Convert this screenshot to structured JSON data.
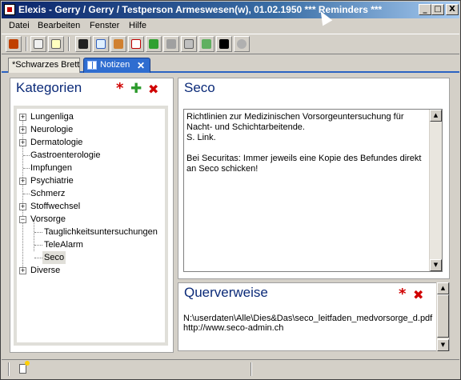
{
  "window": {
    "title": "Elexis - Gerry / Gerry  / Testperson Armeswesen(w), 01.02.1950   *** Reminders ***",
    "controls": {
      "minimize": "_",
      "maximize": "□",
      "close": "X"
    }
  },
  "menu": [
    "Datei",
    "Bearbeiten",
    "Fenster",
    "Hilfe"
  ],
  "toolbar": {
    "icons": [
      "home-icon",
      "list-icon",
      "note-icon",
      "car-icon",
      "chart-icon",
      "people-icon",
      "report-icon",
      "check-icon",
      "up-icon",
      "edit-icon",
      "stamp-icon",
      "black-box-icon",
      "pill-icon"
    ]
  },
  "tabs": [
    {
      "label": "*Schwarzes Brett"
    },
    {
      "label": "Notizen",
      "close": "✕"
    }
  ],
  "kategorien": {
    "title": "Kategorien",
    "star": "*",
    "add": "✚",
    "delete": "✖",
    "tree": [
      {
        "label": "Lungenliga",
        "expandable": true
      },
      {
        "label": "Neurologie",
        "expandable": true
      },
      {
        "label": "Dermatologie",
        "expandable": true
      },
      {
        "label": "Gastroenterologie",
        "expandable": false
      },
      {
        "label": "Impfungen",
        "expandable": false
      },
      {
        "label": "Psychiatrie",
        "expandable": true
      },
      {
        "label": "Schmerz",
        "expandable": false
      },
      {
        "label": "Stoffwechsel",
        "expandable": true
      },
      {
        "label": "Vorsorge",
        "expandable": true,
        "expanded": true
      },
      {
        "label": "Tauglichkeitsuntersuchungen",
        "child": true
      },
      {
        "label": "TeleAlarm",
        "child": true
      },
      {
        "label": "Seco",
        "child": true,
        "selected": true
      },
      {
        "label": "Diverse",
        "expandable": true
      }
    ]
  },
  "note": {
    "title": "Seco",
    "text": "Richtlinien zur Medizinischen Vorsorgeuntersuchung für\nNacht- und Schichtarbeitende.\nS. Link.\n\nBei Securitas: Immer jeweils eine Kopie des Befundes direkt\nan Seco schicken!"
  },
  "querverweise": {
    "title": "Querverweise",
    "star": "*",
    "delete": "✖",
    "items": [
      "N:\\userdaten\\Alle\\Dies&Das\\seco_leitfaden_medvorsorge_d.pdf",
      "http://www.seco-admin.ch"
    ]
  },
  "colors": {
    "title_gradient_start": "#0a246a",
    "title_gradient_end": "#a6caf0",
    "panel_title": "#0b2a78",
    "active_tab": "#2f6dd0",
    "accent_red": "#d00000",
    "accent_green": "#2a9a2a"
  }
}
